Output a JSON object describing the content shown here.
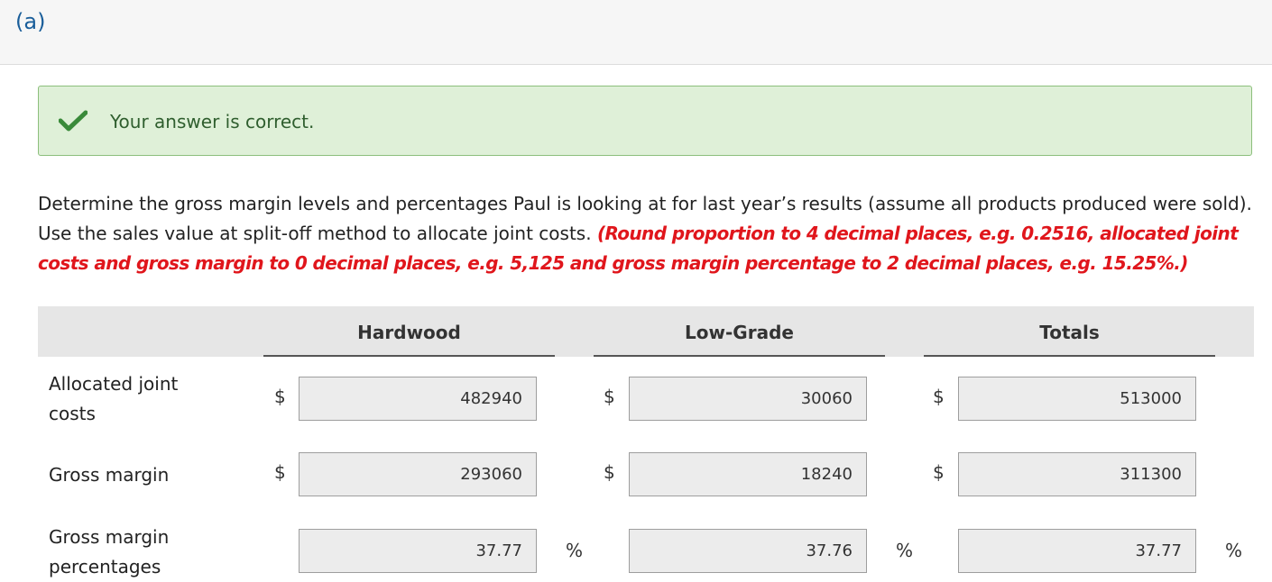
{
  "part_label": "(a)",
  "feedback": {
    "text": "Your answer is correct.",
    "icon": "check-icon",
    "color": "#3a8a3a"
  },
  "instructions": {
    "text": "Determine the gross margin levels and percentages Paul is looking at for last year’s results (assume all products produced were sold). Use the sales value at split-off method to allocate joint costs. ",
    "emphasis": "(Round proportion to 4 decimal places, e.g. 0.2516, allocated joint costs and gross margin to 0 decimal places, e.g. 5,125 and gross margin percentage to 2 decimal places, e.g. 15.25%.)"
  },
  "table": {
    "columns": [
      "Hardwood",
      "Low-Grade",
      "Totals"
    ],
    "rows": [
      {
        "label": "Allocated joint costs",
        "symbol": "$",
        "values": [
          "482940",
          "30060",
          "513000"
        ]
      },
      {
        "label": "Gross margin",
        "symbol": "$",
        "values": [
          "293060",
          "18240",
          "311300"
        ]
      },
      {
        "label": "Gross margin percentages",
        "suffix": "%",
        "values": [
          "37.77",
          "37.76",
          "37.77"
        ]
      }
    ]
  }
}
